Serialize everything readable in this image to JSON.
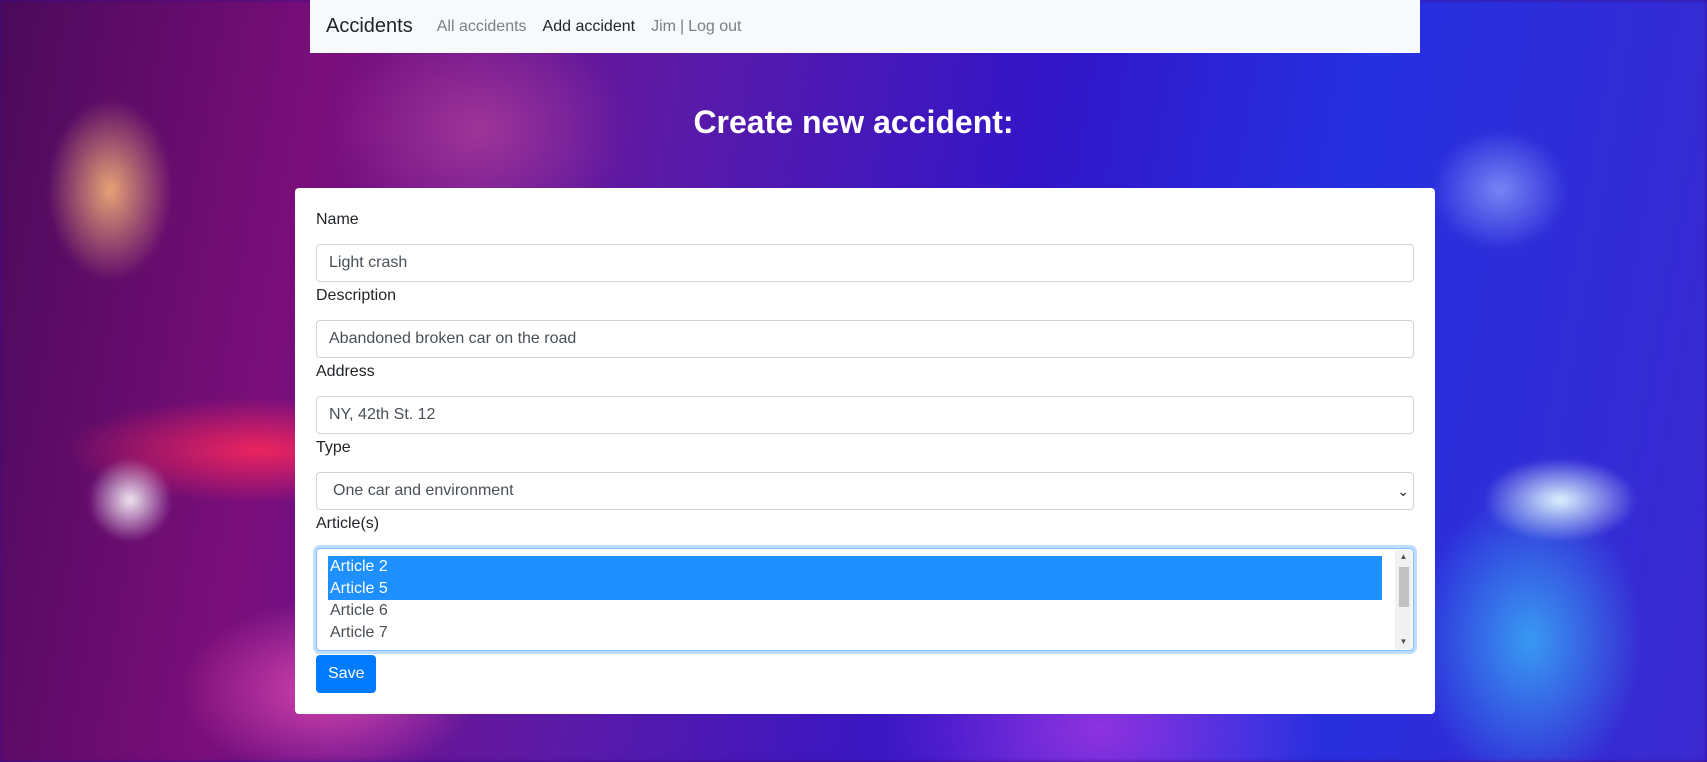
{
  "navbar": {
    "brand": "Accidents",
    "links": [
      {
        "label": "All accidents",
        "active": false
      },
      {
        "label": "Add accident",
        "active": true
      }
    ],
    "user": "Jim",
    "separator": "|",
    "logout": "Log out"
  },
  "heading": "Create new accident:",
  "form": {
    "name": {
      "label": "Name",
      "value": "Light crash"
    },
    "description": {
      "label": "Description",
      "value": "Abandoned broken car on the road"
    },
    "address": {
      "label": "Address",
      "value": "NY, 42th St. 12"
    },
    "type": {
      "label": "Type",
      "value": "One car and environment"
    },
    "articles": {
      "label": "Article(s)",
      "options": [
        {
          "label": "Article 2",
          "selected": true
        },
        {
          "label": "Article 5",
          "selected": true
        },
        {
          "label": "Article 6",
          "selected": false
        },
        {
          "label": "Article 7",
          "selected": false
        }
      ]
    },
    "save_label": "Save"
  },
  "colors": {
    "primary": "#007bff",
    "selection": "#1e90ff",
    "navbar_bg": "#f8f9fa"
  },
  "icons": {
    "type_select": "chevron-down-icon",
    "scroll_up": "scroll-up-arrow-icon",
    "scroll_down": "scroll-down-arrow-icon"
  }
}
